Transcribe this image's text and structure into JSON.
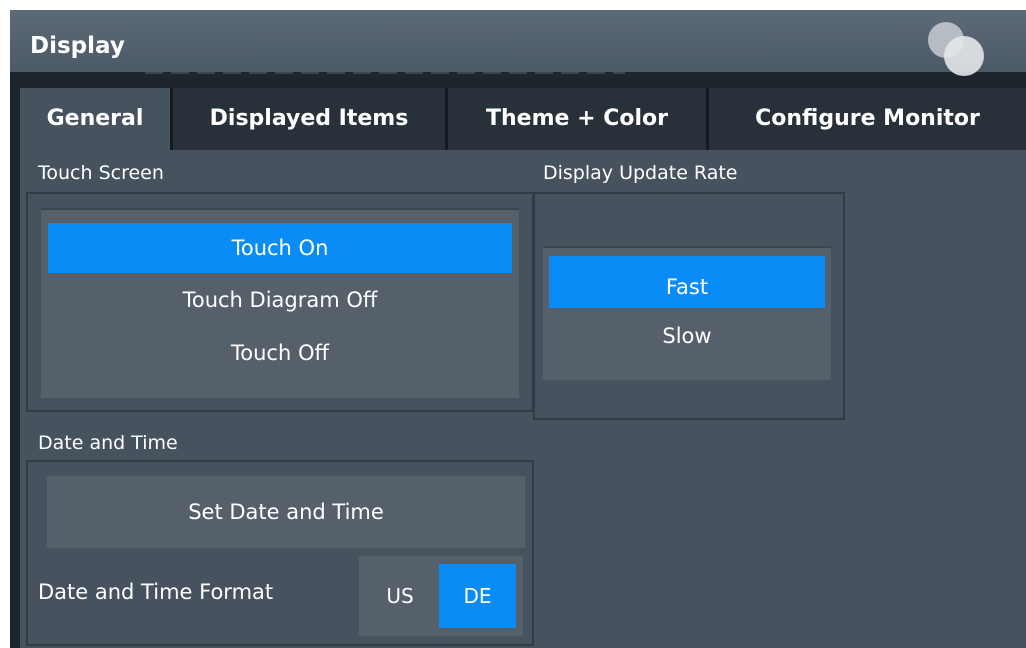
{
  "window": {
    "title": "Display",
    "logo_icon": "rohde-schwarz-logo"
  },
  "tabs": [
    {
      "label": "General",
      "active": true
    },
    {
      "label": "Displayed Items",
      "active": false
    },
    {
      "label": "Theme + Color",
      "active": false
    },
    {
      "label": "Configure Monitor",
      "active": false
    }
  ],
  "touch_screen": {
    "label": "Touch Screen",
    "options": [
      "Touch On",
      "Touch Diagram Off",
      "Touch Off"
    ],
    "selected": "Touch On"
  },
  "display_update_rate": {
    "label": "Display Update Rate",
    "options": [
      "Fast",
      "Slow"
    ],
    "selected": "Fast"
  },
  "date_time": {
    "label": "Date and Time",
    "set_button": "Set Date and Time",
    "format_label": "Date and Time Format",
    "format_options": [
      "US",
      "DE"
    ],
    "format_selected": "DE"
  },
  "colors": {
    "accent": "#0a8cf6",
    "panel": "#46525e",
    "background": "#1d242c",
    "tab_inactive": "#283039"
  }
}
